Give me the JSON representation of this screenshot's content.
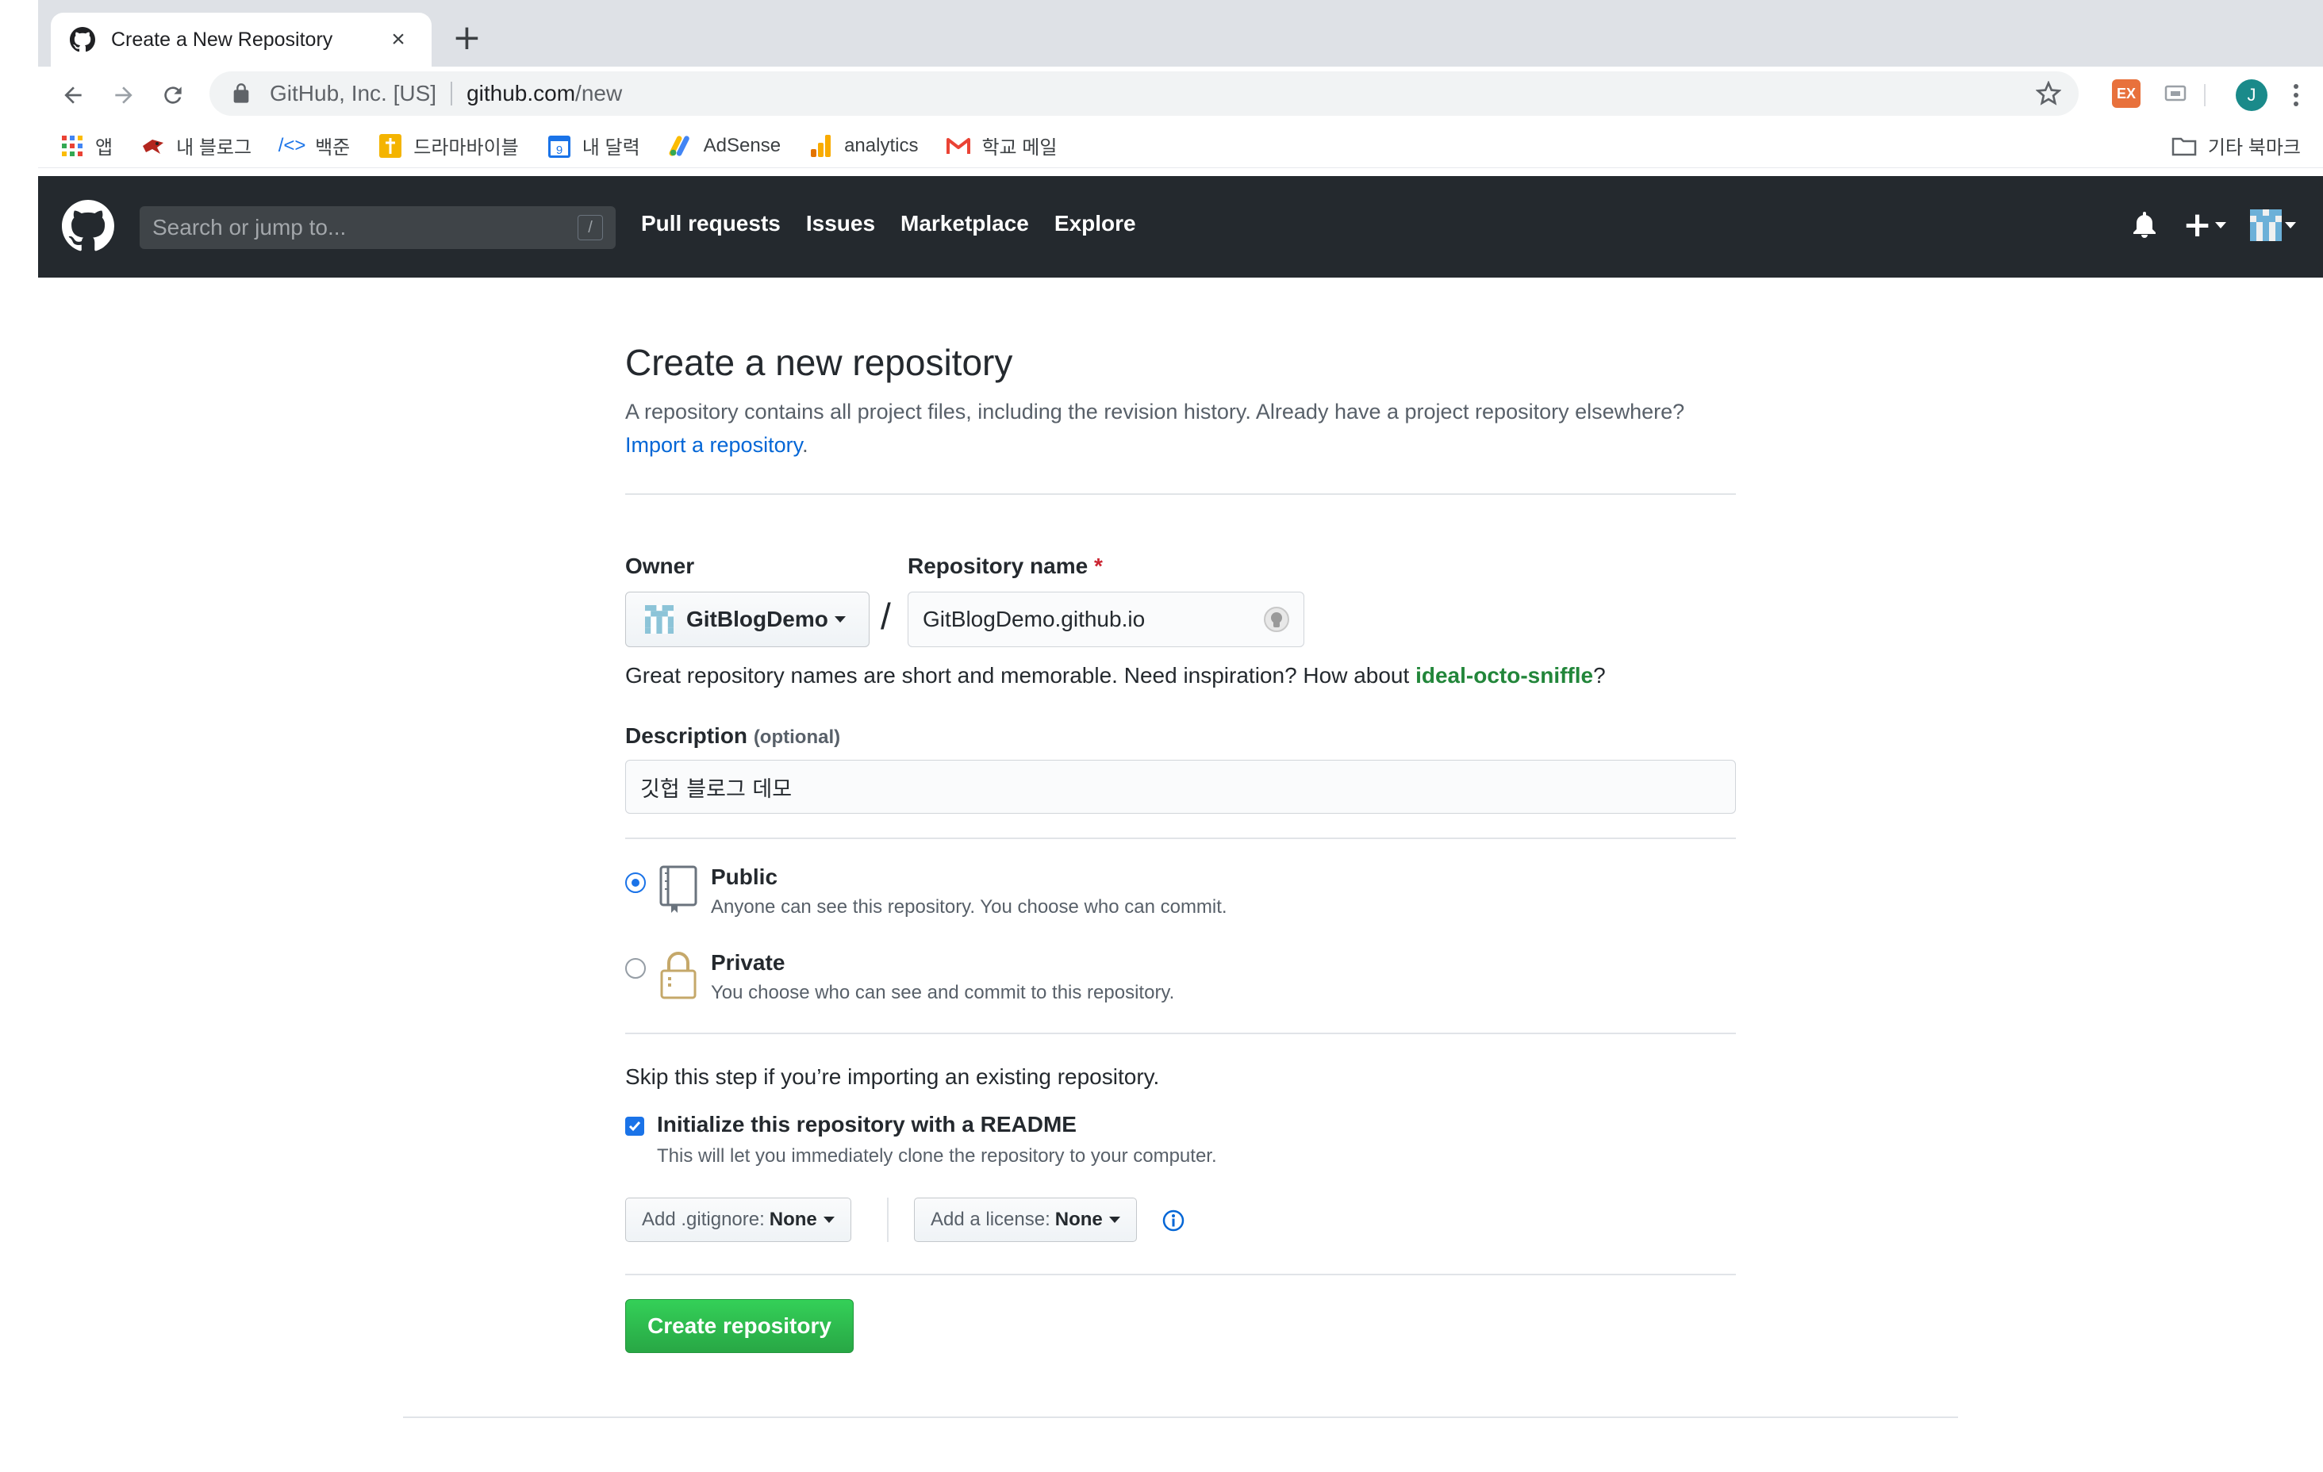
{
  "browser": {
    "tab_title": "Create a New Repository",
    "tab_close": "×",
    "new_tab": "+",
    "site_identity": "GitHub, Inc. [US]",
    "url_host": "github.com",
    "url_path": "/new",
    "ext_label": "EX",
    "profile_initial": "J",
    "bookmarks": [
      "앱",
      "내 블로그",
      "백준",
      "드라마바이블",
      "내 달력",
      "AdSense",
      "analytics",
      "학교 메일"
    ],
    "calendar_day": "9",
    "other_bookmarks": "기타 북마크"
  },
  "header": {
    "search_placeholder": "Search or jump to...",
    "search_key": "/",
    "nav": [
      "Pull requests",
      "Issues",
      "Marketplace",
      "Explore"
    ],
    "plus": "+"
  },
  "page": {
    "title": "Create a new repository",
    "subtitle_text": "A repository contains all project files, including the revision history. Already have a project repository elsewhere? ",
    "import_link": "Import a repository",
    "subtitle_end": ".",
    "owner_label": "Owner",
    "repo_label": "Repository name",
    "required_mark": "*",
    "owner_value": "GitBlogDemo",
    "slash": "/",
    "repo_value": "GitBlogDemo.github.io",
    "inspiration_text": "Great repository names are short and memorable. Need inspiration? How about ",
    "inspiration_suggestion": "ideal-octo-sniffle",
    "inspiration_end": "?",
    "description_label": "Description",
    "description_optional": "(optional)",
    "description_value": "깃헙 블로그 데모",
    "public_title": "Public",
    "public_desc": "Anyone can see this repository. You choose who can commit.",
    "private_title": "Private",
    "private_desc": "You choose who can see and commit to this repository.",
    "skip_note": "Skip this step if you’re importing an existing repository.",
    "init_label": "Initialize this repository with a README",
    "init_desc": "This will let you immediately clone the repository to your computer.",
    "gitignore_label": "Add .gitignore:",
    "gitignore_value": "None",
    "license_label": "Add a license:",
    "license_value": "None",
    "create_button": "Create repository"
  },
  "colors": {
    "header_bg": "#24292e",
    "create_green": "#28a745",
    "link_blue": "#0366d6",
    "suggest_green": "#22863a"
  }
}
